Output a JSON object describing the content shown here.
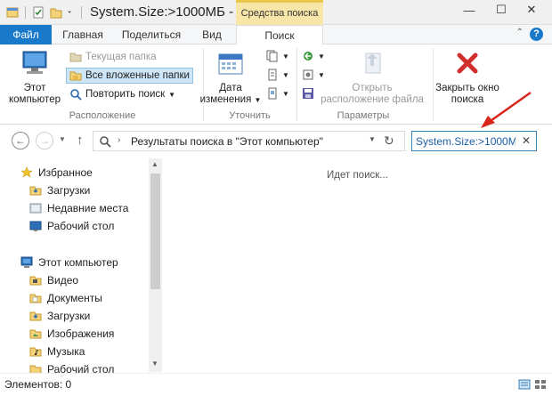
{
  "title_bar": {
    "title": "System.Size:>1000МБ -",
    "context_tab": "Средства поиска",
    "minimize": "—",
    "maximize": "☐",
    "close": "✕"
  },
  "tabs": [
    {
      "label": "Файл"
    },
    {
      "label": "Главная"
    },
    {
      "label": "Поделиться"
    },
    {
      "label": "Вид"
    },
    {
      "label": "Поиск"
    }
  ],
  "help_label": "?",
  "ribbon": {
    "location": {
      "this_pc_label": "Этот компьютер",
      "current_folder": "Текущая папка",
      "all_subfolders": "Все вложенные папки",
      "search_again": "Повторить поиск",
      "group_label": "Расположение"
    },
    "refine": {
      "date_modified": "Дата изменения",
      "group_label": "Уточнить"
    },
    "options": {
      "open_location": "Открыть расположение файла",
      "group_label": "Параметры"
    },
    "close_search": "Закрыть окно поиска"
  },
  "address_bar": {
    "path": "Результаты поиска в \"Этот компьютер\"",
    "refresh_icon": "refresh-icon"
  },
  "search_box": {
    "value": "System.Size:>1000МБ",
    "clear": "✕"
  },
  "nav_pane": {
    "favorites": {
      "label": "Избранное",
      "items": [
        {
          "label": "Загрузки",
          "icon": "downloads-folder-icon"
        },
        {
          "label": "Недавние места",
          "icon": "recent-places-icon"
        },
        {
          "label": "Рабочий стол",
          "icon": "desktop-icon"
        }
      ]
    },
    "this_pc": {
      "label": "Этот компьютер",
      "items": [
        {
          "label": "Видео",
          "icon": "videos-folder-icon"
        },
        {
          "label": "Документы",
          "icon": "documents-folder-icon"
        },
        {
          "label": "Загрузки",
          "icon": "downloads-folder-icon"
        },
        {
          "label": "Изображения",
          "icon": "pictures-folder-icon"
        },
        {
          "label": "Музыка",
          "icon": "music-folder-icon"
        },
        {
          "label": "Рабочий стол",
          "icon": "desktop-folder-icon"
        }
      ]
    }
  },
  "content": {
    "status_message": "Идет поиск..."
  },
  "status_bar": {
    "items_text": "Элементов: 0"
  },
  "colors": {
    "file_tab": "#1979ca",
    "context_tab": "#f7e6a8",
    "annotation_arrow": "#d9261c"
  }
}
